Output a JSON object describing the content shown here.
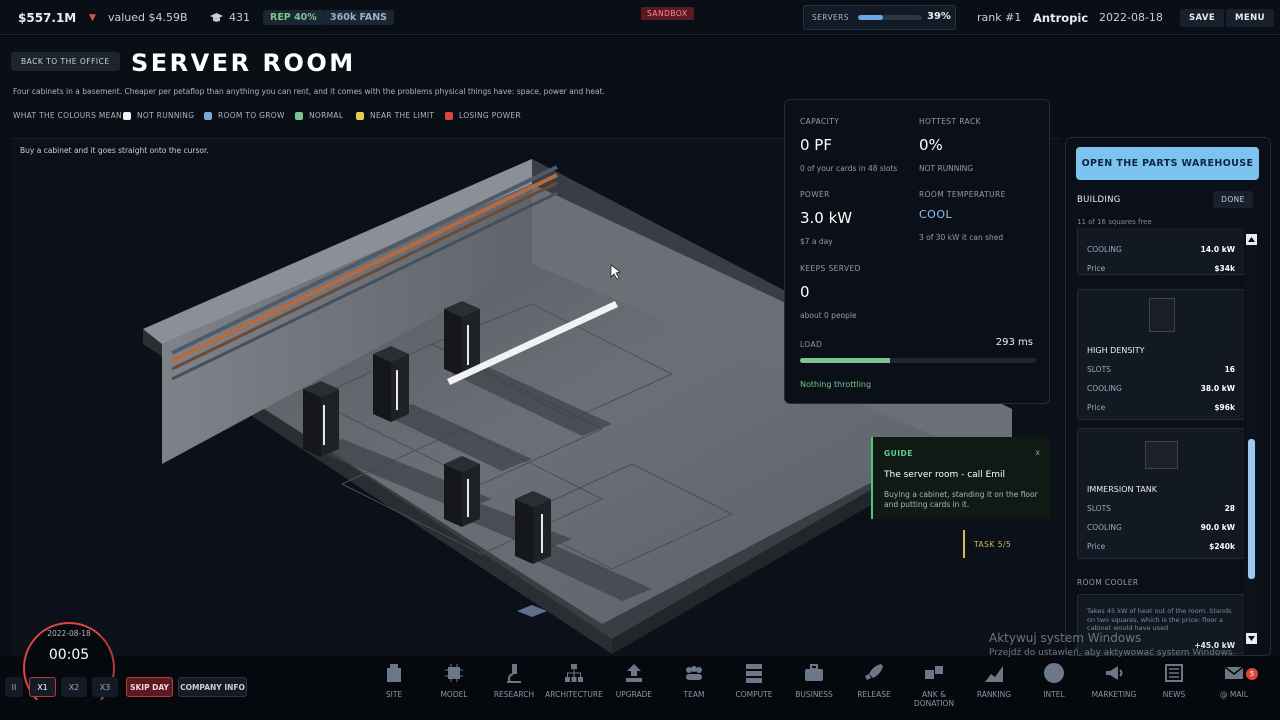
{
  "topbar": {
    "money": "$557.1M",
    "valued": "valued $4.59B",
    "researchers": "431",
    "rep": "REP 40%",
    "fans": "360k FANS",
    "sandbox": "SANDBOX",
    "servers_label": "SERVERS",
    "servers_pct": "39%",
    "servers_fill": 0.39,
    "rank": "rank #1",
    "company": "Antropic",
    "date": "2022-08-18",
    "save": "SAVE",
    "menu": "MENU"
  },
  "header": {
    "back": "BACK TO THE OFFICE",
    "title": "SERVER ROOM",
    "description": "Four cabinets in a basement. Cheaper per petaflop than anything you can rent, and it comes with the problems physical things have: space, power and heat."
  },
  "legend": {
    "title": "WHAT THE COLOURS MEAN",
    "items": [
      {
        "label": "NOT RUNNING",
        "color": "#f2f2f2"
      },
      {
        "label": "ROOM TO GROW",
        "color": "#7fa7d9"
      },
      {
        "label": "NORMAL",
        "color": "#7cc48f"
      },
      {
        "label": "NEAR THE LIMIT",
        "color": "#e6cc4c"
      },
      {
        "label": "LOSING POWER",
        "color": "#d9463f"
      }
    ]
  },
  "scene": {
    "hint": "Buy a cabinet and it goes straight onto the cursor."
  },
  "stats": {
    "capacity_label": "CAPACITY",
    "capacity": "0 PF",
    "capacity_sub": "0 of your cards in 48 slots",
    "hottest_label": "HOTTEST RACK",
    "hottest": "0%",
    "hottest_sub": "NOT RUNNING",
    "power_label": "POWER",
    "power": "3.0 kW",
    "power_sub": "$7 a day",
    "temp_label": "ROOM TEMPERATURE",
    "temp": "COOL",
    "temp_sub": "3 of 30 kW it can shed",
    "keeps_label": "KEEPS SERVED",
    "keeps": "0",
    "keeps_sub": "about 0 people",
    "load_label": "LOAD",
    "load_ms": "293 ms",
    "load_fill": 0.38,
    "throttle": "Nothing throttling"
  },
  "guide": {
    "label": "GUIDE",
    "close": "x",
    "title": "The server room - call Emil",
    "body": "Buying a cabinet, standing it on the floor and putting cards in it.",
    "task": "TASK 5/5"
  },
  "side": {
    "warehouse": "OPEN THE PARTS WAREHOUSE",
    "building": "BUILDING",
    "done": "DONE",
    "squares": "11 of 16 squares free",
    "partial": {
      "cooling_label": "COOLING",
      "cooling": "14.0 kW",
      "price_label": "Price",
      "price": "$34k"
    },
    "cards": [
      {
        "name": "HIGH DENSITY",
        "slots_label": "SLOTS",
        "slots": "16",
        "cooling_label": "COOLING",
        "cooling": "38.0 kW",
        "price_label": "Price",
        "price": "$96k"
      },
      {
        "name": "IMMERSION TANK",
        "slots_label": "SLOTS",
        "slots": "28",
        "cooling_label": "COOLING",
        "cooling": "90.0 kW",
        "price_label": "Price",
        "price": "$240k"
      }
    ],
    "cooler_title": "ROOM COOLER",
    "cooler_text": "Takes 45 kW of heat out of the room. Stands on two squares, which is the price: floor a cabinet would have used",
    "cooler_cooling": "+45.0 kW"
  },
  "clock": {
    "date": "2022-08-18",
    "time": "00:05"
  },
  "controls": {
    "pause": "II",
    "x1": "X1",
    "x2": "X2",
    "x3": "X3",
    "skip": "SKIP DAY",
    "info": "COMPANY INFO"
  },
  "nav": [
    {
      "label": "SITE",
      "icon": "site-icon"
    },
    {
      "label": "MODEL",
      "icon": "chip-icon"
    },
    {
      "label": "RESEARCH",
      "icon": "microscope-icon"
    },
    {
      "label": "ARCHITECTURE",
      "icon": "hierarchy-icon"
    },
    {
      "label": "UPGRADE",
      "icon": "upgrade-icon"
    },
    {
      "label": "TEAM",
      "icon": "team-icon"
    },
    {
      "label": "COMPUTE",
      "icon": "server-icon"
    },
    {
      "label": "BUSINESS",
      "icon": "briefcase-icon"
    },
    {
      "label": "RELEASE",
      "icon": "rocket-icon"
    },
    {
      "label": "ANK & DONATION",
      "icon": "blocks-icon"
    },
    {
      "label": "RANKING",
      "icon": "chart-icon"
    },
    {
      "label": "INTEL",
      "icon": "circle-icon"
    },
    {
      "label": "MARKETING",
      "icon": "megaphone-icon"
    },
    {
      "label": "NEWS",
      "icon": "newspaper-icon"
    },
    {
      "label": "@ MAIL",
      "icon": "mail-icon"
    }
  ],
  "mail_badge": "5",
  "watermark": {
    "line1": "Aktywuj system Windows",
    "line2": "Przejdź do ustawień, aby aktywować system Windows."
  }
}
